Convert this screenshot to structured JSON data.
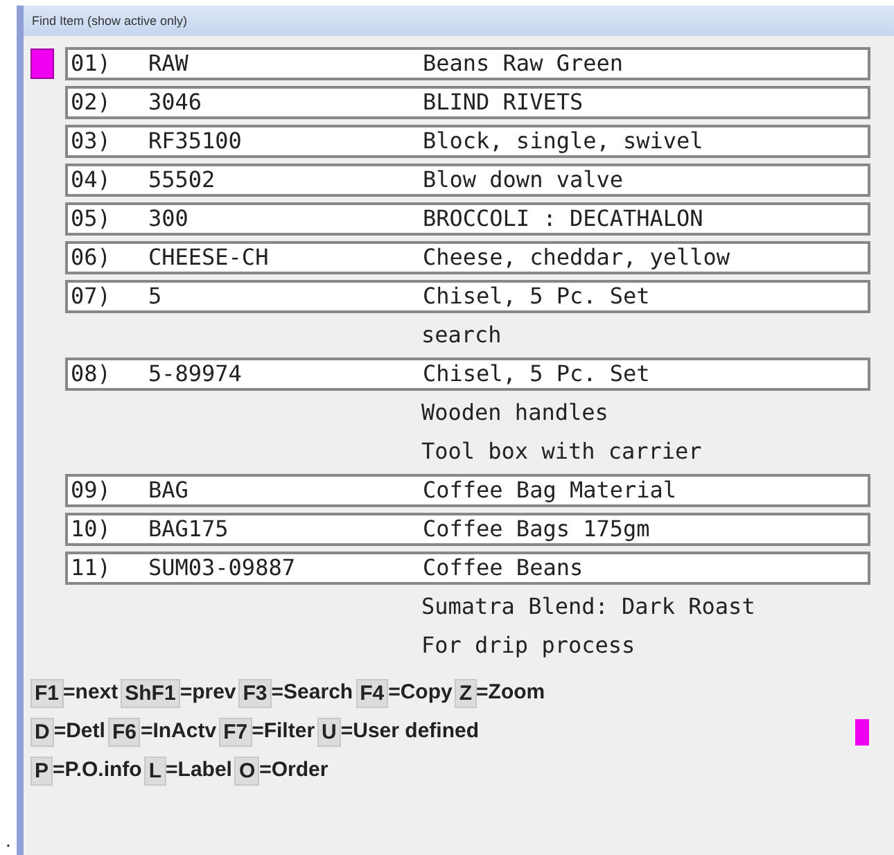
{
  "window": {
    "title": "Find Item (show active only)"
  },
  "items": [
    {
      "number": "01)",
      "code": "RAW",
      "description": "Beans Raw Green",
      "selected": true
    },
    {
      "number": "02)",
      "code": "3046",
      "description": "BLIND RIVETS",
      "selected": false
    },
    {
      "number": "03)",
      "code": "RF35100",
      "description": "Block, single, swivel",
      "selected": false
    },
    {
      "number": "04)",
      "code": "55502",
      "description": "Blow down valve",
      "selected": false
    },
    {
      "number": "05)",
      "code": "300",
      "description": "BROCCOLI : DECATHALON",
      "selected": false
    },
    {
      "number": "06)",
      "code": "CHEESE-CH",
      "description": "Cheese, cheddar, yellow",
      "selected": false
    },
    {
      "number": "07)",
      "code": "5",
      "description": "Chisel, 5 Pc. Set",
      "selected": false,
      "extra_lines": [
        "search"
      ]
    },
    {
      "number": "08)",
      "code": "5-89974",
      "description": "Chisel, 5 Pc. Set",
      "selected": false,
      "extra_lines": [
        "Wooden handles",
        "Tool box with carrier"
      ]
    },
    {
      "number": "09)",
      "code": "BAG",
      "description": "Coffee Bag Material",
      "selected": false
    },
    {
      "number": "10)",
      "code": "BAG175",
      "description": "Coffee Bags 175gm",
      "selected": false
    },
    {
      "number": "11)",
      "code": "SUM03-09887",
      "description": "Coffee Beans",
      "selected": false,
      "extra_lines": [
        "Sumatra Blend: Dark Roast",
        "For drip process"
      ]
    }
  ],
  "key_lines": [
    {
      "keys": [
        {
          "key": "F1",
          "action": "=next"
        },
        {
          "key": "ShF1",
          "action": "=prev"
        },
        {
          "key": "F3",
          "action": "=Search"
        },
        {
          "key": "F4",
          "action": "=Copy"
        },
        {
          "key": "Z",
          "action": "=Zoom"
        }
      ]
    },
    {
      "keys": [
        {
          "key": "D",
          "action": "=Detl"
        },
        {
          "key": "F6",
          "action": "=InActv"
        },
        {
          "key": "F7",
          "action": "=Filter"
        },
        {
          "key": "U",
          "action": "=User defined"
        }
      ],
      "cursor": true
    },
    {
      "keys": [
        {
          "key": "P",
          "action": "=P.O.info"
        },
        {
          "key": "L",
          "action": "=Label"
        },
        {
          "key": "O",
          "action": "=Order"
        }
      ]
    }
  ],
  "stray_mark": "."
}
